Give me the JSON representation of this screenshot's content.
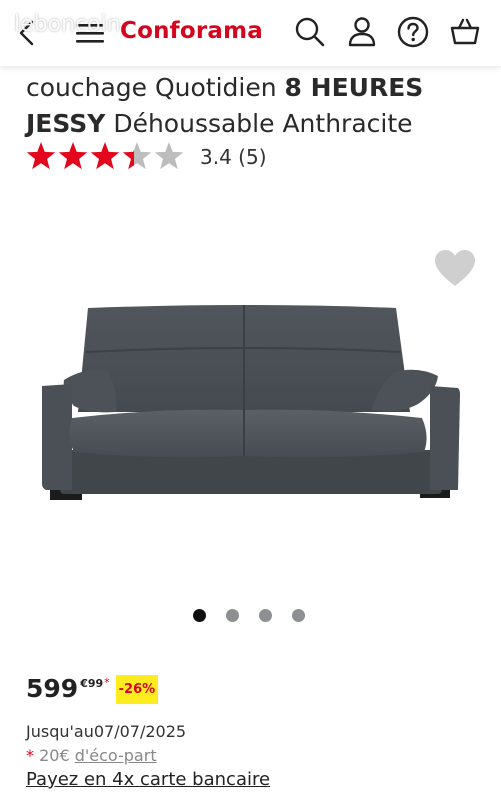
{
  "header": {
    "watermark": "leboncoin",
    "brand": "Conforama",
    "icons": [
      "back-icon",
      "menu-icon",
      "search-icon",
      "account-icon",
      "help-icon",
      "basket-icon"
    ]
  },
  "product": {
    "title_line1": "couchage Quotidien ",
    "title_line1_bold": "8 HEURES",
    "title_line2_bold": "JESSY",
    "title_line2": " Déhoussable Anthracite",
    "rating_value": 3.4,
    "rating_max": 5,
    "rating_text": "3.4 (5)",
    "gallery": {
      "total": 4,
      "active": 1
    },
    "favorite_icon": "heart-icon"
  },
  "price": {
    "integer": "599",
    "cents": "€99",
    "asterisk": "*",
    "discount": "-26%",
    "until": "Jusqu'au07/07/2025",
    "eco_star": "*",
    "eco_prefix": " 20€ ",
    "eco_link": "d'éco-part",
    "installments": "Payez en 4x carte bancaire"
  },
  "colors": {
    "brand_red": "#d6051f",
    "star_red": "#e3061c",
    "star_empty": "#bdbdbd",
    "badge_yellow": "#ffec1f",
    "sofa_grey": "#4a5056"
  }
}
